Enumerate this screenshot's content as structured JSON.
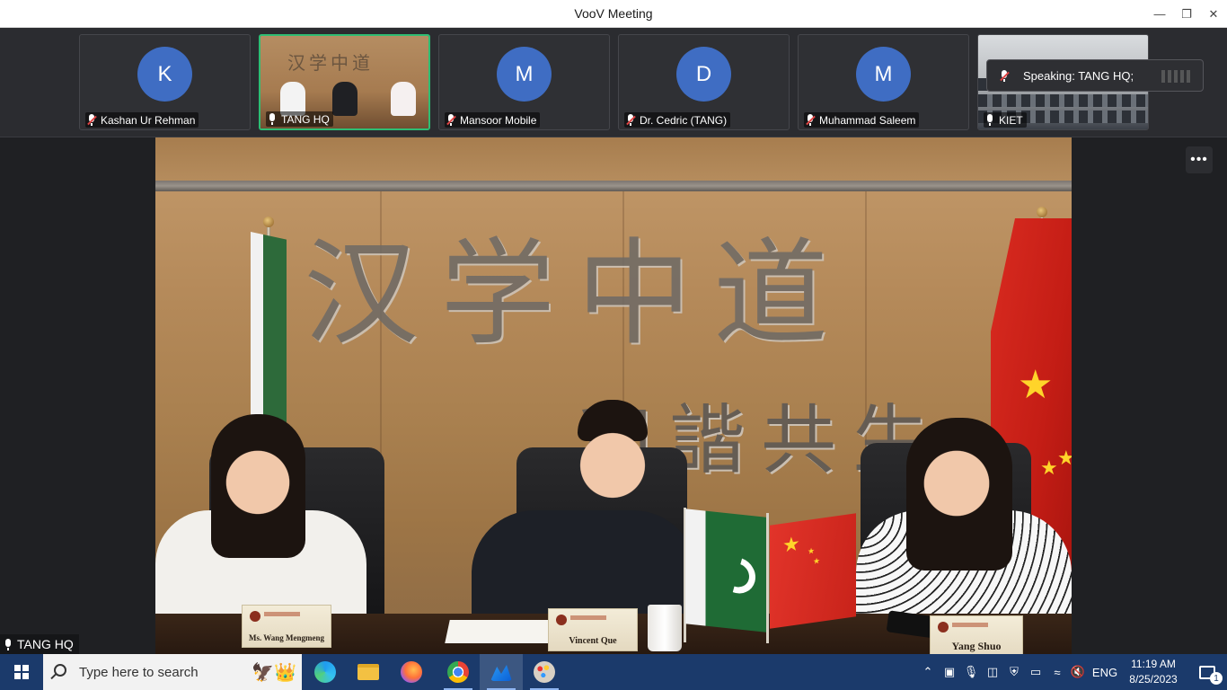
{
  "window": {
    "title": "VooV Meeting"
  },
  "gallery": {
    "tiles": [
      {
        "name": "Kashan Ur Rehman",
        "initial": "K",
        "muted": true
      },
      {
        "name": "TANG HQ",
        "initial": "",
        "muted": false
      },
      {
        "name": "Mansoor Mobile",
        "initial": "M",
        "muted": true
      },
      {
        "name": "Dr. Cedric (TANG)",
        "initial": "D",
        "muted": true
      },
      {
        "name": "Muhammad Saleem",
        "initial": "M",
        "muted": true
      },
      {
        "name": "KIET",
        "initial": "",
        "muted": false
      }
    ],
    "speaking_label": "Speaking: TANG HQ;"
  },
  "main_video": {
    "nameplates": [
      "Ms. Wang Mengmeng",
      "Vincent Que",
      "Yang Shuo"
    ],
    "speaker_tag": "TANG HQ"
  },
  "more_button": "•••",
  "taskbar": {
    "search_placeholder": "Type here to search",
    "apps": [
      "edge-icon",
      "file-explorer-icon",
      "firefox-icon",
      "chrome-icon",
      "voov-meeting-icon",
      "paint-icon"
    ],
    "language": "ENG",
    "time": "11:19 AM",
    "date": "8/25/2023",
    "notification_count": "1"
  },
  "colors": {
    "accent_active": "#2ebd73",
    "avatar": "#3f6dc3",
    "taskbar": "#1b3a6b",
    "muted": "#e04444"
  }
}
